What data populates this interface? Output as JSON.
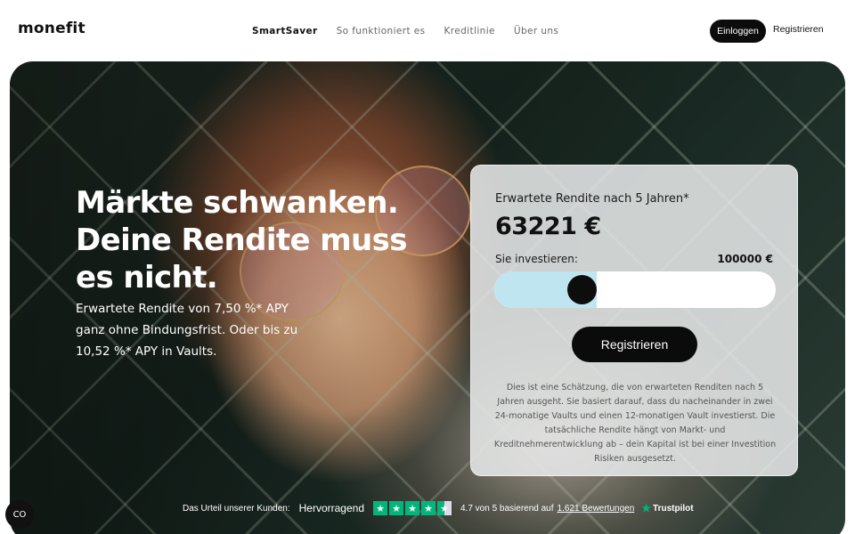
{
  "header": {
    "logo": "monefit",
    "nav": [
      "SmartSaver",
      "So funktioniert es",
      "Kreditlinie",
      "Über uns"
    ],
    "login_label": "Einloggen",
    "register_label": "Registrieren"
  },
  "hero": {
    "headline_lines": [
      "Märkte schwanken.",
      "Deine Rendite muss",
      "es nicht."
    ],
    "subtext": "Erwartete Rendite von 7,50 %* APY ganz ohne Bindungsfrist. Oder bis zu 10,52 %* APY in Vaults."
  },
  "calculator": {
    "label": "Erwartete Rendite nach 5 Jahren*",
    "amount": "63221 €",
    "invest_label": "Sie investieren:",
    "invest_value": "100000 €",
    "slider_level": 0.29,
    "button_label": "Registrieren",
    "disclaimer": "Dies ist eine Schätzung, die von erwarteten Renditen nach 5 Jahren ausgeht. Sie basiert darauf, dass du nacheinander in zwei 24-monatige Vaults und einen 12-monatigen Vault investierst. Die tatsächliche Rendite hängt von Markt- und Kreditnehmerentwicklung ab – dein Kapital ist bei einer Investition Risiken ausgesetzt."
  },
  "trustpilot": {
    "lead": "Das Urteil unserer Kunden:",
    "rating_word": "Hervorragend",
    "stars": 4.5,
    "score_text": "4.7 von 5 basierend auf",
    "reviews_link": "1.621 Bewertungen",
    "brand": "Trustpilot"
  },
  "cookie": {
    "icon": "cookie-settings-icon",
    "glyph": "CO"
  },
  "colors": {
    "accent": "#bfe5f0",
    "primary": "#0b0b0b",
    "trustpilot_green": "#00b67a"
  }
}
